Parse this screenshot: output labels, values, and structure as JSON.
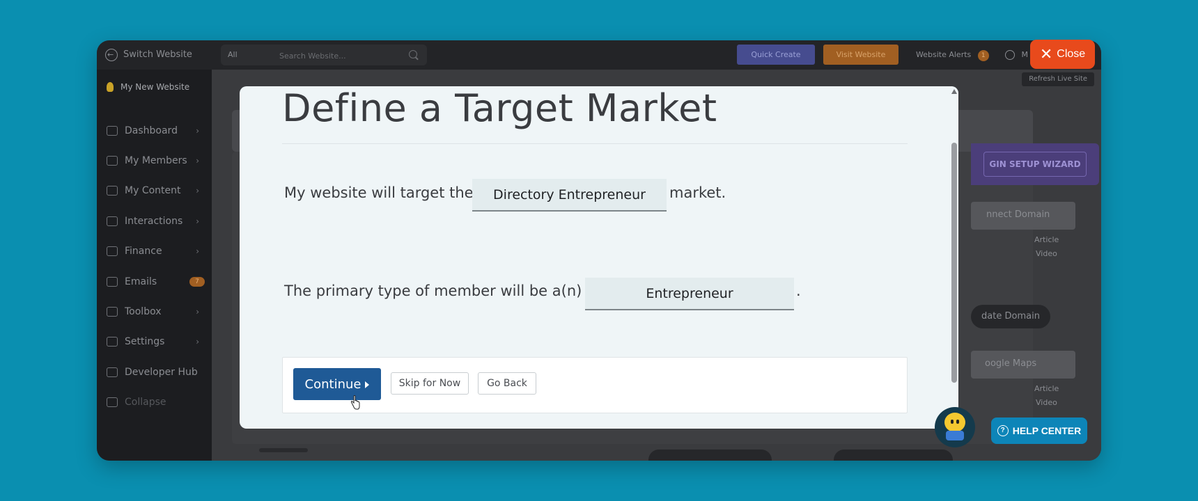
{
  "topbar": {
    "switch_website": "Switch Website",
    "search_scope": "All",
    "search_placeholder": "Search Website...",
    "quick_create": "Quick Create",
    "visit_website": "Visit Website",
    "website_alerts": "Website Alerts",
    "alerts_count": "1",
    "account": "M",
    "close": "Close"
  },
  "sidebar": {
    "site_name": "My New Website",
    "items": [
      {
        "label": "Dashboard",
        "icon": "home-icon"
      },
      {
        "label": "My Members",
        "icon": "members-icon"
      },
      {
        "label": "My Content",
        "icon": "folder-icon"
      },
      {
        "label": "Interactions",
        "icon": "chat-icon"
      },
      {
        "label": "Finance",
        "icon": "chart-icon"
      },
      {
        "label": "Emails",
        "icon": "mail-icon",
        "badge": "7"
      },
      {
        "label": "Toolbox",
        "icon": "tools-icon"
      },
      {
        "label": "Settings",
        "icon": "gear-icon"
      },
      {
        "label": "Developer Hub",
        "icon": "grid-icon"
      },
      {
        "label": "Collapse",
        "icon": "collapse-icon"
      }
    ]
  },
  "background": {
    "refresh_live_site": "Refresh Live Site",
    "wizard_button": "GIN SETUP WIZARD",
    "connect_domain": "nnect Domain",
    "article": "Article",
    "video": "Video",
    "update_domain": "date Domain",
    "google_maps": "oogle Maps",
    "article2": "Article",
    "video2": "Video"
  },
  "modal": {
    "title": "Define a Target Market",
    "sentence1_prefix": "My website will target the",
    "target_market_value": "Directory Entrepreneur",
    "sentence1_suffix": "market.",
    "sentence2_prefix": "The primary type of member will be a(n)",
    "member_type_value": "Entrepreneur",
    "sentence2_suffix": ".",
    "continue": "Continue",
    "skip": "Skip for Now",
    "go_back": "Go Back"
  },
  "help_center": "HELP CENTER"
}
